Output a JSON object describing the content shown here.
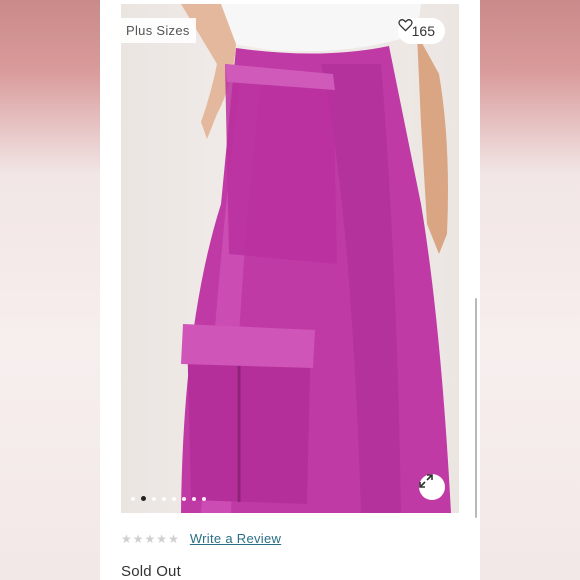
{
  "listing": {
    "tag": "Plus Sizes",
    "like_count": "165",
    "like_icon": "heart-icon",
    "expand_icon": "expand-icon",
    "carousel": {
      "total": 8,
      "active_index": 1
    },
    "colors": {
      "skirt": "#c03aa6",
      "link": "#2a6f86"
    }
  },
  "review": {
    "rating_stars": 0,
    "max_stars": 5,
    "link_label": "Write a Review"
  },
  "status": "Sold Out"
}
